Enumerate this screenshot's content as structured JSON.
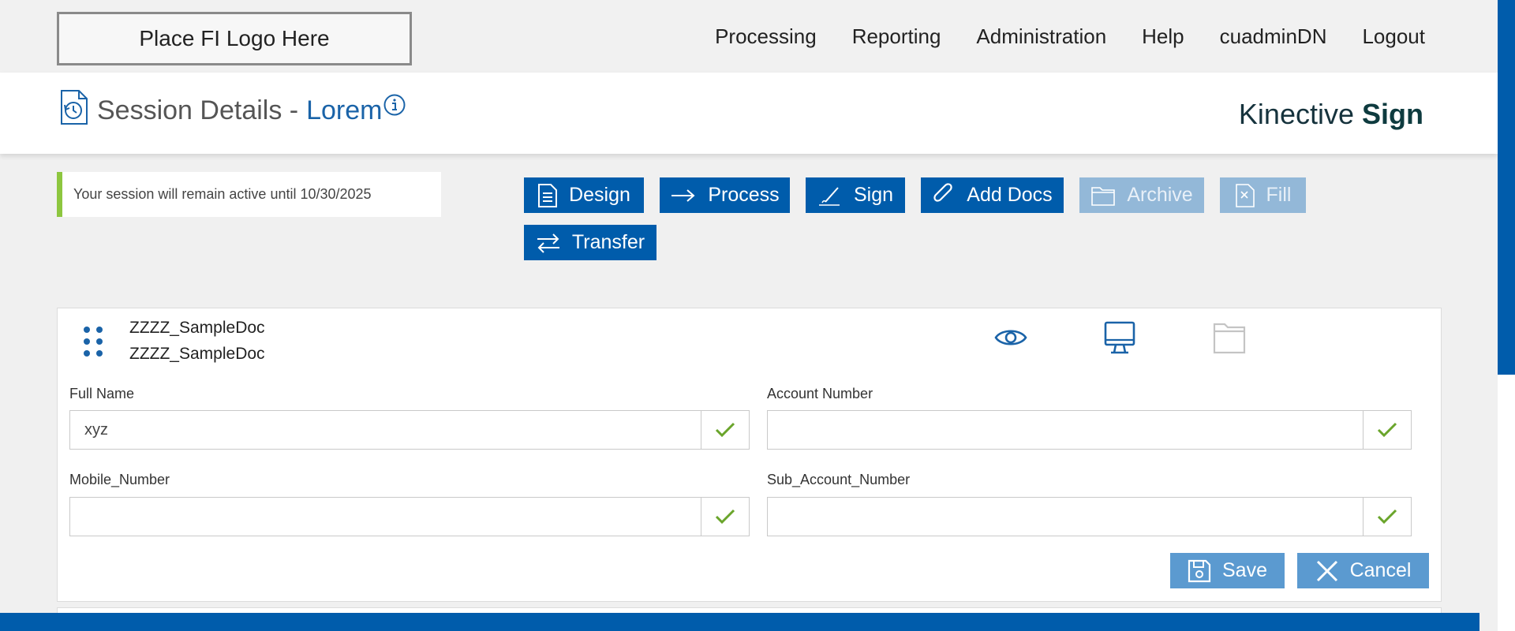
{
  "header": {
    "logo_text": "Place FI Logo Here",
    "nav": [
      "Processing",
      "Reporting",
      "Administration",
      "Help",
      "cuadminDN",
      "Logout"
    ]
  },
  "session": {
    "title_prefix": "Session Details -",
    "title_name": "Lorem",
    "brand_light": "Kinective",
    "brand_bold": "Sign"
  },
  "notice": {
    "text": "Your session will remain active until 10/30/2025"
  },
  "actions": {
    "design": "Design",
    "process": "Process",
    "sign": "Sign",
    "add_docs": "Add Docs",
    "archive": "Archive",
    "fill": "Fill",
    "transfer": "Transfer"
  },
  "document": {
    "name_1": "ZZZZ_SampleDoc",
    "name_2": "ZZZZ_SampleDoc",
    "icons": [
      "eye-icon",
      "monitor-icon",
      "folder-icon"
    ]
  },
  "fields": {
    "full_name": {
      "label": "Full Name",
      "value": "xyz"
    },
    "account_number": {
      "label": "Account Number",
      "value": ""
    },
    "mobile_number": {
      "label": "Mobile_Number",
      "value": ""
    },
    "sub_account_number": {
      "label": "Sub_Account_Number",
      "value": ""
    }
  },
  "form_actions": {
    "save": "Save",
    "cancel": "Cancel"
  },
  "colors": {
    "primary": "#005cab",
    "accent_green": "#8dc63f",
    "check_green": "#6aa52b",
    "disabled": "#93b8d8",
    "brand_dark": "#0e3b3f"
  }
}
